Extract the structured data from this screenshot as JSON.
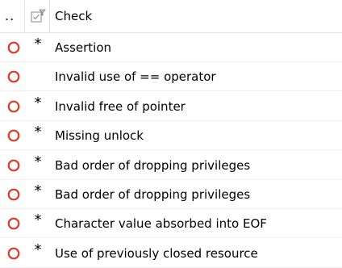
{
  "header": {
    "ellipsis": "..",
    "flag_icon": "checkbox-flag-icon",
    "check_label": "Check"
  },
  "colors": {
    "status_ring": "#e23a2a",
    "grid_line": "#e3e3e3"
  },
  "rows": [
    {
      "status_icon": "status-circle-icon",
      "flag": "*",
      "label": "Assertion"
    },
    {
      "status_icon": "status-circle-icon",
      "flag": "",
      "label": "Invalid use of == operator"
    },
    {
      "status_icon": "status-circle-icon",
      "flag": "*",
      "label": "Invalid free of pointer"
    },
    {
      "status_icon": "status-circle-icon",
      "flag": "*",
      "label": "Missing unlock"
    },
    {
      "status_icon": "status-circle-icon",
      "flag": "*",
      "label": "Bad order of dropping privileges"
    },
    {
      "status_icon": "status-circle-icon",
      "flag": "*",
      "label": "Bad order of dropping privileges"
    },
    {
      "status_icon": "status-circle-icon",
      "flag": "*",
      "label": "Character value absorbed into EOF"
    },
    {
      "status_icon": "status-circle-icon",
      "flag": "*",
      "label": "Use of previously closed resource"
    }
  ]
}
